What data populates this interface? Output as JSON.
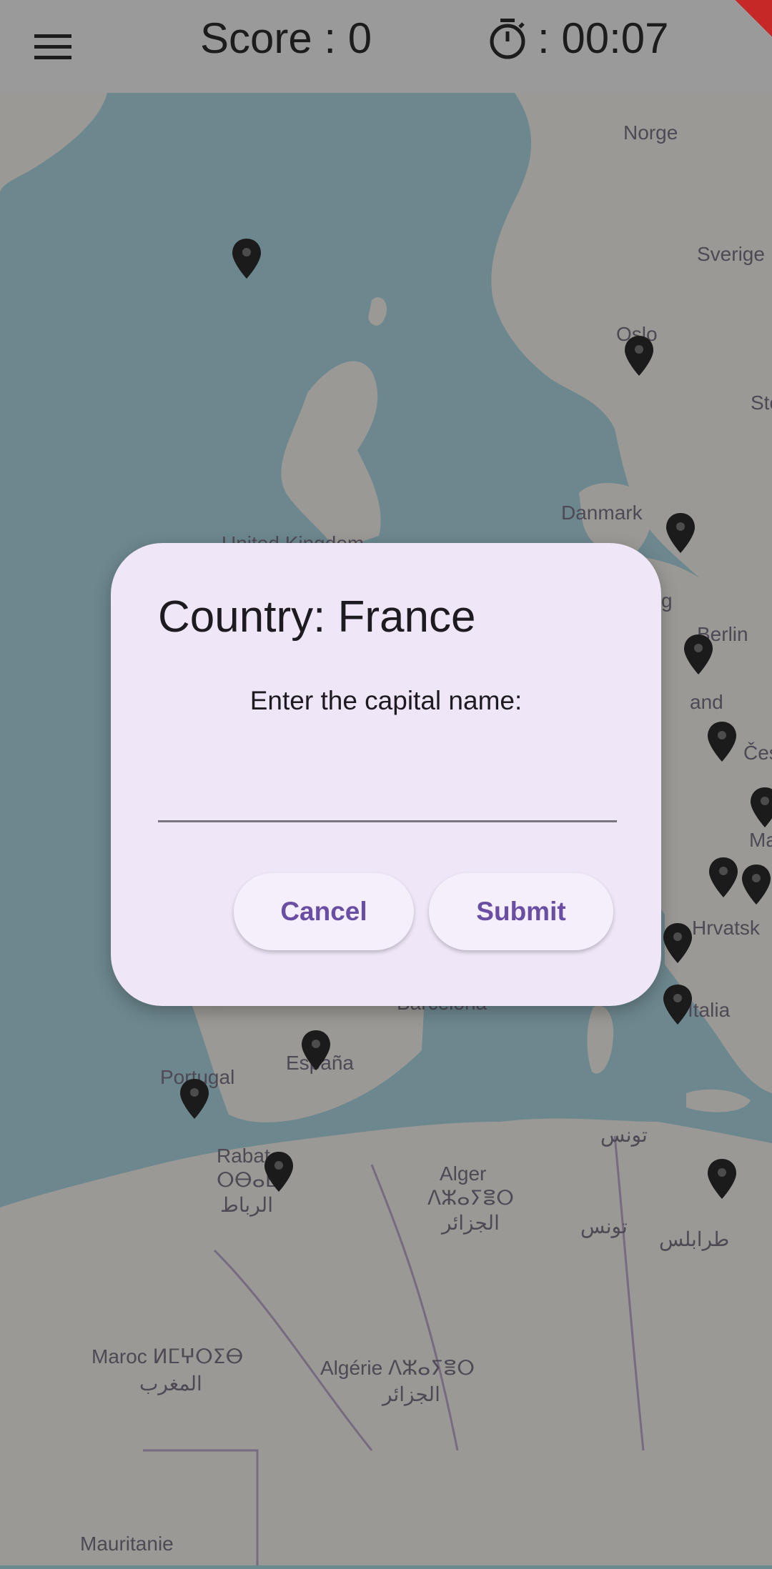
{
  "header": {
    "score_label": "Score : 0",
    "timer_value": ": 00:07",
    "menu_icon": "hamburger-menu-icon",
    "timer_icon": "stopwatch-icon"
  },
  "map": {
    "labels": {
      "norge": "Norge",
      "sverige": "Sverige",
      "oslo": "Oslo",
      "sto": "Sto",
      "danmark": "Danmark",
      "berlin": "Berlin",
      "land": "and",
      "cesko": "Česko",
      "ma": "Ma",
      "hrvatska": "Hrvatsk",
      "italia": "Italia",
      "barcelona": "Barcelona",
      "espana": "España",
      "portugal": "Portugal",
      "rabat": "Rabat",
      "rabat_tf": "ⵔⴱⴰⵟ",
      "rabat_ar": "الرباط",
      "alger": "Alger",
      "alger_tf": "ⴷⵣⴰⵢⴻⵔ",
      "alger_ar": "الجزائر",
      "tunis_ar": "تونس",
      "tunis_ar2": "تونس",
      "tripoli_ar": "طرابلس",
      "maroc": "Maroc ⵍⵎⵖⵔⵉⴱ",
      "maroc_ar": "المغرب",
      "algerie": "Algérie ⴷⵣⴰⵢⴻⵔ",
      "algerie_ar": "الجزائر",
      "mauritanie": "Mauritanie",
      "uk": "United Kingdom",
      "g": "g"
    },
    "marker_icon": "map-pin-icon",
    "colors": {
      "water": "#aad3df",
      "land": "#f2efe9",
      "marker": "#2b2b2b"
    }
  },
  "dialog": {
    "title": "Country: France",
    "prompt": "Enter the capital name:",
    "input_value": "",
    "cancel_label": "Cancel",
    "submit_label": "Submit",
    "accent": "#6a4ea3",
    "background": "#efe6f7"
  }
}
